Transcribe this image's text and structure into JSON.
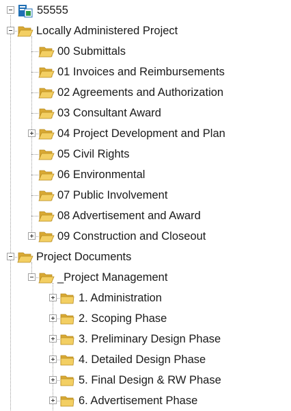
{
  "tree": {
    "root": {
      "label": "55555",
      "expanded": true,
      "icon": "project-icon"
    },
    "nodes": [
      {
        "label": "Locally Administered Project",
        "level": 1,
        "expander": "minus",
        "open": true
      },
      {
        "label": "00 Submittals",
        "level": 2,
        "expander": "none",
        "open": true
      },
      {
        "label": "01 Invoices and Reimbursements",
        "level": 2,
        "expander": "none",
        "open": true
      },
      {
        "label": "02 Agreements and Authorization",
        "level": 2,
        "expander": "none",
        "open": true
      },
      {
        "label": "03 Consultant Award",
        "level": 2,
        "expander": "none",
        "open": true
      },
      {
        "label": "04 Project Development and Plan",
        "level": 2,
        "expander": "plus",
        "open": true
      },
      {
        "label": "05 Civil Rights",
        "level": 2,
        "expander": "none",
        "open": true
      },
      {
        "label": "06 Environmental",
        "level": 2,
        "expander": "none",
        "open": true
      },
      {
        "label": "07 Public Involvement",
        "level": 2,
        "expander": "none",
        "open": true
      },
      {
        "label": "08 Advertisement and Award",
        "level": 2,
        "expander": "none",
        "open": true
      },
      {
        "label": "09 Construction and Closeout",
        "level": 2,
        "expander": "plus",
        "open": true
      },
      {
        "label": "Project Documents",
        "level": 1,
        "expander": "minus",
        "open": true
      },
      {
        "label": "_Project Management",
        "level": 2,
        "expander": "minus",
        "open": true
      },
      {
        "label": "1.  Administration",
        "level": 3,
        "expander": "plus",
        "open": false
      },
      {
        "label": "2.  Scoping Phase",
        "level": 3,
        "expander": "plus",
        "open": false
      },
      {
        "label": "3.  Preliminary Design Phase",
        "level": 3,
        "expander": "plus",
        "open": false
      },
      {
        "label": "4.  Detailed Design Phase",
        "level": 3,
        "expander": "plus",
        "open": false
      },
      {
        "label": "5.  Final Design & RW Phase",
        "level": 3,
        "expander": "plus",
        "open": false
      },
      {
        "label": "6.  Advertisement Phase",
        "level": 3,
        "expander": "plus",
        "open": false
      }
    ]
  },
  "colors": {
    "folder_front": "#f3cf63",
    "folder_back": "#d9a934",
    "folder_outline": "#b88a1e",
    "tree_lines": "#9a9a9a",
    "project_icon_blue": "#1f6fb5",
    "project_icon_green": "#2e9b48"
  }
}
